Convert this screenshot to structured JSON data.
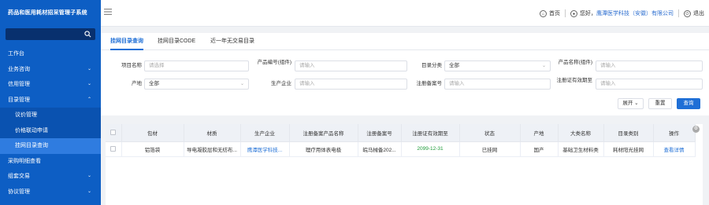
{
  "app": {
    "title": "药品和医用耗材招采管理子系统"
  },
  "sidebar": {
    "search_placeholder": "",
    "items": [
      {
        "label": "工作台",
        "arrow": ""
      },
      {
        "label": "业务咨询",
        "arrow": "⌄"
      },
      {
        "label": "信用管理",
        "arrow": "⌄"
      },
      {
        "label": "目录管理",
        "arrow": "⌃"
      },
      {
        "label": "议价管理",
        "sub": true
      },
      {
        "label": "价格联动申请",
        "sub": true
      },
      {
        "label": "挂网目录查询",
        "sub": true,
        "active": true
      },
      {
        "label": "采购明细查看",
        "arrow": ""
      },
      {
        "label": "组套交易",
        "arrow": "⌄"
      },
      {
        "label": "协议管理",
        "arrow": "⌄"
      }
    ]
  },
  "header": {
    "home": "首页",
    "greeting": "您好，",
    "user": "鹰潭医学科技（安徽）有限公司",
    "logout": "退出"
  },
  "tabs": [
    "挂网目录查询",
    "挂网目录CODE",
    "近一年无交易目录"
  ],
  "filters": {
    "bundle_label": "项目名称",
    "bundle_placeholder": "请选择",
    "code_label": "产品编号(组件)",
    "code_placeholder": "请输入",
    "category_label": "目录分类",
    "category_value": "全部",
    "product_label": "产品名称(组件)",
    "product_placeholder": "请输入",
    "origin_label": "产地",
    "origin_value": "全部",
    "maker_label": "生产企业",
    "maker_placeholder": "请输入",
    "reg_label": "注册备案号",
    "reg_placeholder": "请输入",
    "expiry_label": "注册证有效期至",
    "expiry_placeholder": "请输入",
    "expand_btn": "展开",
    "reset_btn": "重置",
    "query_btn": "查询"
  },
  "table": {
    "headers": [
      "包材",
      "材质",
      "生产企业",
      "注册备案产品名称",
      "注册备案号",
      "注册证有效期至",
      "状态",
      "产地",
      "大类名称",
      "目录类别",
      "操作"
    ],
    "rows": [
      [
        "铝箔袋",
        "导电凝胶层和无纺布...",
        "鹰潭医学科技...",
        "理疗用体表电极",
        "皖马械备202...",
        "2099-12-31",
        "已挂网",
        "国产",
        "基础卫生材料类",
        "耗材阳光挂网",
        "查看详情"
      ]
    ]
  }
}
